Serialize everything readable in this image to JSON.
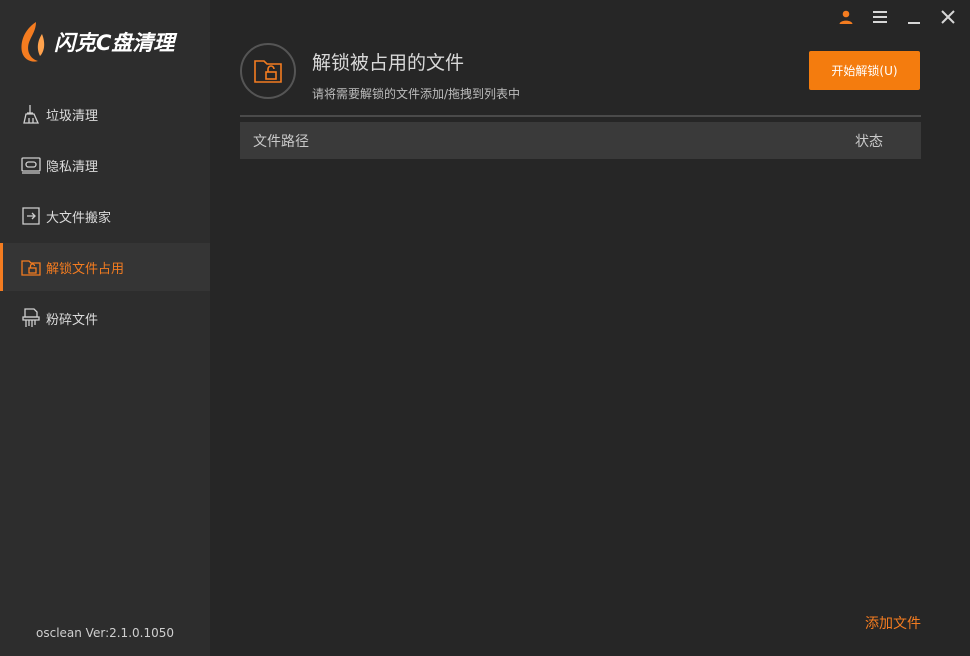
{
  "app": {
    "title": "闪克C盘清理",
    "version": "osclean Ver:2.1.0.1050",
    "accent_color": "#f47c20"
  },
  "window_controls": {
    "icons": [
      "user-icon",
      "menu-icon",
      "minimize-icon",
      "close-icon"
    ]
  },
  "sidebar": {
    "items": [
      {
        "label": "垃圾清理",
        "icon": "broom-icon",
        "active": false
      },
      {
        "label": "隐私清理",
        "icon": "privacy-icon",
        "active": false
      },
      {
        "label": "大文件搬家",
        "icon": "move-file-icon",
        "active": false
      },
      {
        "label": "解锁文件占用",
        "icon": "unlock-folder-icon",
        "active": true
      },
      {
        "label": "粉碎文件",
        "icon": "shredder-icon",
        "active": false
      }
    ]
  },
  "main": {
    "title": "解锁被占用的文件",
    "subtitle": "请将需要解锁的文件添加/拖拽到列表中",
    "start_button": "开始解锁(U)",
    "table": {
      "columns": [
        "文件路径",
        "状态"
      ],
      "rows": []
    },
    "add_file_link": "添加文件"
  }
}
